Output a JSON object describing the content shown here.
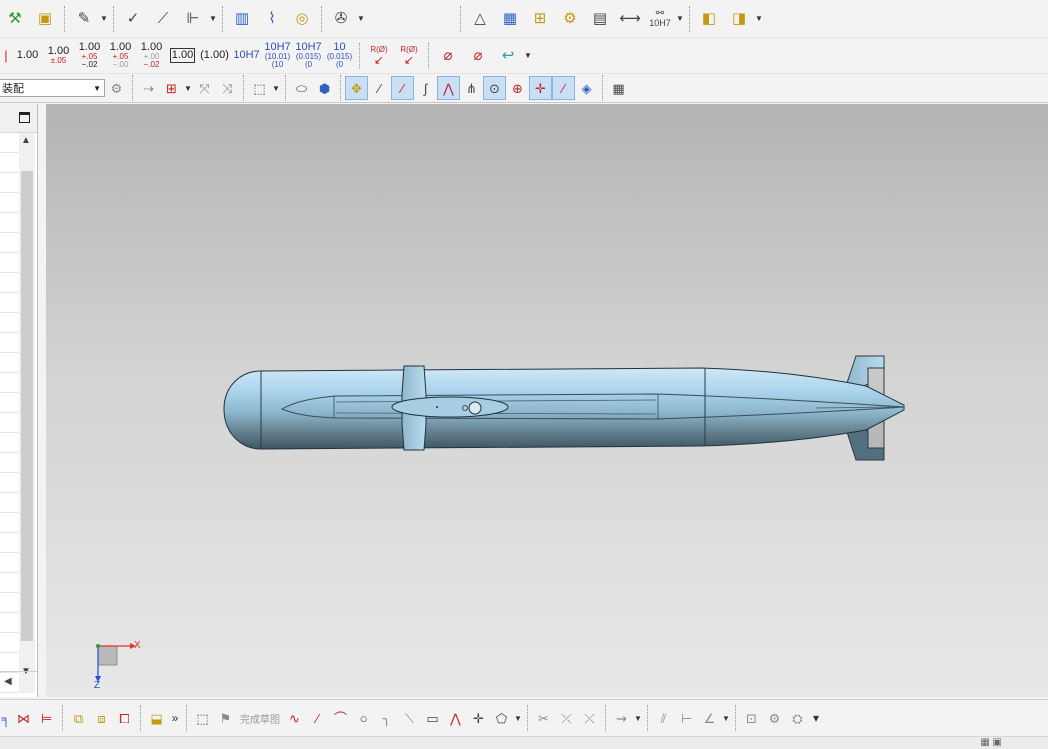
{
  "toolbar_row2": {
    "dims": [
      {
        "main": "1.00"
      },
      {
        "main": "1.00",
        "tol": "±.05"
      },
      {
        "main": "1.00",
        "tol": "+.05",
        "tol2": "−.02"
      },
      {
        "main": "1.00",
        "tol": "+.05",
        "tol2": "−.00"
      },
      {
        "main": "1.00",
        "tol": "+.00",
        "tol2": "−.02"
      },
      {
        "main": "1.00"
      },
      {
        "main": "(1.00)"
      },
      {
        "main": "10H7"
      },
      {
        "main": "10H7",
        "tol": "(10.01)",
        "tol2": "(10"
      },
      {
        "main": "10H7",
        "tol": "(0.015)",
        "tol2": "(0"
      },
      {
        "main": "10",
        "tol": "(0.015)",
        "tol2": "(0"
      }
    ],
    "radius_label_1": "R(Ø)",
    "radius_label_2": "R(Ø)"
  },
  "toolbar_row1": {
    "tolerance_label": "10H7"
  },
  "toolbar_row3": {
    "filter_combo": "装配"
  },
  "bottom_bar": {
    "finish_sketch_label": "完成草图"
  },
  "triad": {
    "x_label": "X",
    "z_label": "Z"
  },
  "colors": {
    "model_light": "#a9d3ec",
    "model_dark": "#5c7b8d",
    "viewport_top": "#b4b4b4",
    "viewport_bottom": "#e8e8e8",
    "triad_x": "#e03030",
    "triad_z": "#2050d0"
  }
}
